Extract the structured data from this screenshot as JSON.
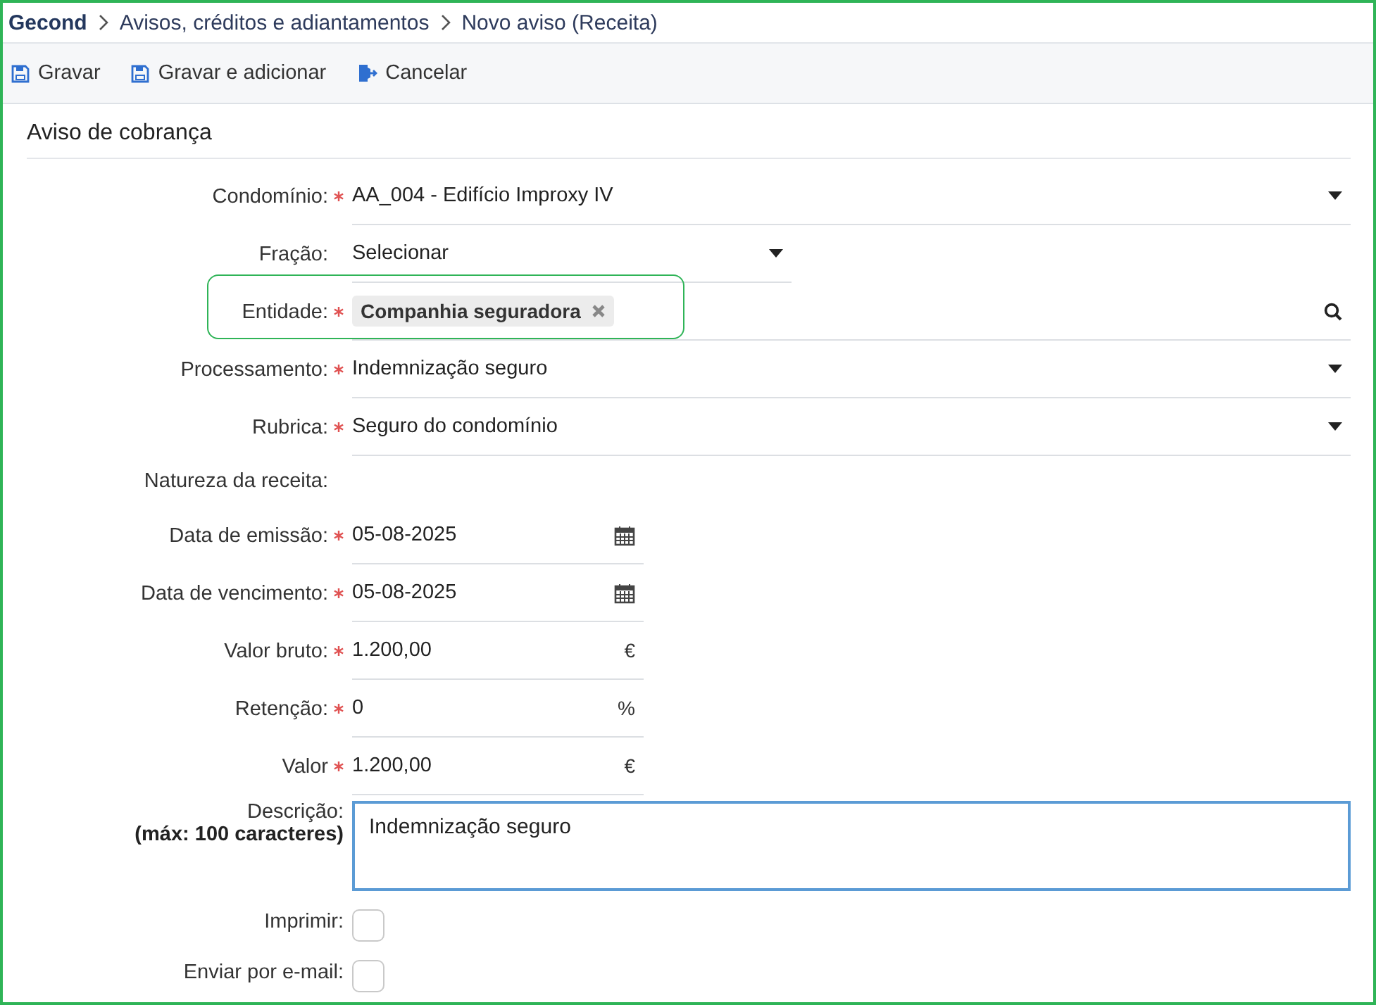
{
  "breadcrumb": [
    {
      "label": "Gecond"
    },
    {
      "label": "Avisos, créditos e adiantamentos"
    },
    {
      "label": "Novo aviso (Receita)"
    }
  ],
  "toolbar": [
    {
      "label": "Gravar",
      "kind": "save"
    },
    {
      "label": "Gravar e adicionar",
      "kind": "save"
    },
    {
      "label": "Cancelar",
      "kind": "exit"
    }
  ],
  "section": {
    "title": "Aviso de cobrança"
  },
  "fields": [
    {
      "kind": "select",
      "label": "Condomínio:",
      "required": true,
      "value": "AA_004 - Edifício Improxy IV"
    },
    {
      "kind": "choice",
      "label": "Fração:",
      "required": false,
      "value": "Selecionar"
    },
    {
      "kind": "tags",
      "label": "Entidade:",
      "required": true,
      "tags": [
        "Companhia seguradora"
      ],
      "highlighted": true
    },
    {
      "kind": "select",
      "label": "Processamento:",
      "required": true,
      "value": "Indemnização seguro"
    },
    {
      "kind": "select",
      "label": "Rubrica:",
      "required": true,
      "value": "Seguro do condomínio"
    },
    {
      "kind": "static",
      "label": "Natureza da receita:",
      "required": false
    },
    {
      "kind": "date",
      "label": "Data de emissão:",
      "required": true,
      "value": "05-08-2025"
    },
    {
      "kind": "date",
      "label": "Data de vencimento:",
      "required": true,
      "value": "05-08-2025"
    },
    {
      "kind": "unit",
      "label": "Valor bruto:",
      "required": true,
      "value": "1.200,00",
      "unit": "€"
    },
    {
      "kind": "unit",
      "label": "Retenção:",
      "required": true,
      "value": "0",
      "unit": "%"
    },
    {
      "kind": "unit",
      "label": "Valor",
      "required": true,
      "value": "1.200,00",
      "unit": "€"
    },
    {
      "kind": "textarea",
      "label": "Descrição:",
      "hint": "(máx: 100 caracteres)",
      "value": "Indemnização seguro",
      "focused": true
    },
    {
      "kind": "checkbox",
      "label": "Imprimir:",
      "checked": false
    },
    {
      "kind": "checkbox",
      "label": "Enviar por e-mail:",
      "checked": false
    }
  ]
}
